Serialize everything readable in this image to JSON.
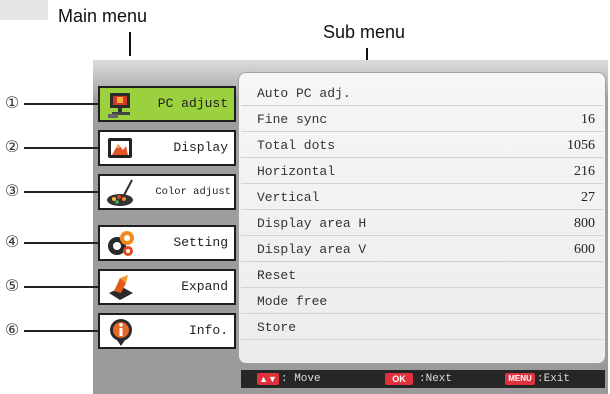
{
  "captions": {
    "main_menu": "Main menu",
    "sub_menu": "Sub menu"
  },
  "main_menu": {
    "items": [
      {
        "num": "①",
        "label": "PC adjust",
        "icon": "pc-adjust-icon",
        "active": true
      },
      {
        "num": "②",
        "label": "Display",
        "icon": "display-icon",
        "active": false
      },
      {
        "num": "③",
        "label": "Color adjust",
        "icon": "color-adjust-icon",
        "active": false
      },
      {
        "num": "④",
        "label": "Setting",
        "icon": "setting-icon",
        "active": false
      },
      {
        "num": "⑤",
        "label": "Expand",
        "icon": "expand-icon",
        "active": false
      },
      {
        "num": "⑥",
        "label": "Info.",
        "icon": "info-icon",
        "active": false
      }
    ]
  },
  "sub_menu": {
    "rows": [
      {
        "label": "Auto PC adj.",
        "value": ""
      },
      {
        "label": "Fine sync",
        "value": "16"
      },
      {
        "label": "Total dots",
        "value": "1056"
      },
      {
        "label": "Horizontal",
        "value": "216"
      },
      {
        "label": "Vertical",
        "value": "27"
      },
      {
        "label": "Display area H",
        "value": "800"
      },
      {
        "label": "Display area V",
        "value": "600"
      },
      {
        "label": "Reset",
        "value": ""
      },
      {
        "label": "Mode free",
        "value": ""
      },
      {
        "label": "Store",
        "value": ""
      }
    ]
  },
  "status_bar": {
    "move_text": ": Move",
    "ok_key": "OK",
    "next_text": ":Next",
    "menu_key": "MENU",
    "exit_text": ":Exit"
  },
  "colors": {
    "active_item": "#9bd13e",
    "panel_gray": "#9f9f9f",
    "key_red": "#e0323c",
    "status_bar": "#262626"
  }
}
